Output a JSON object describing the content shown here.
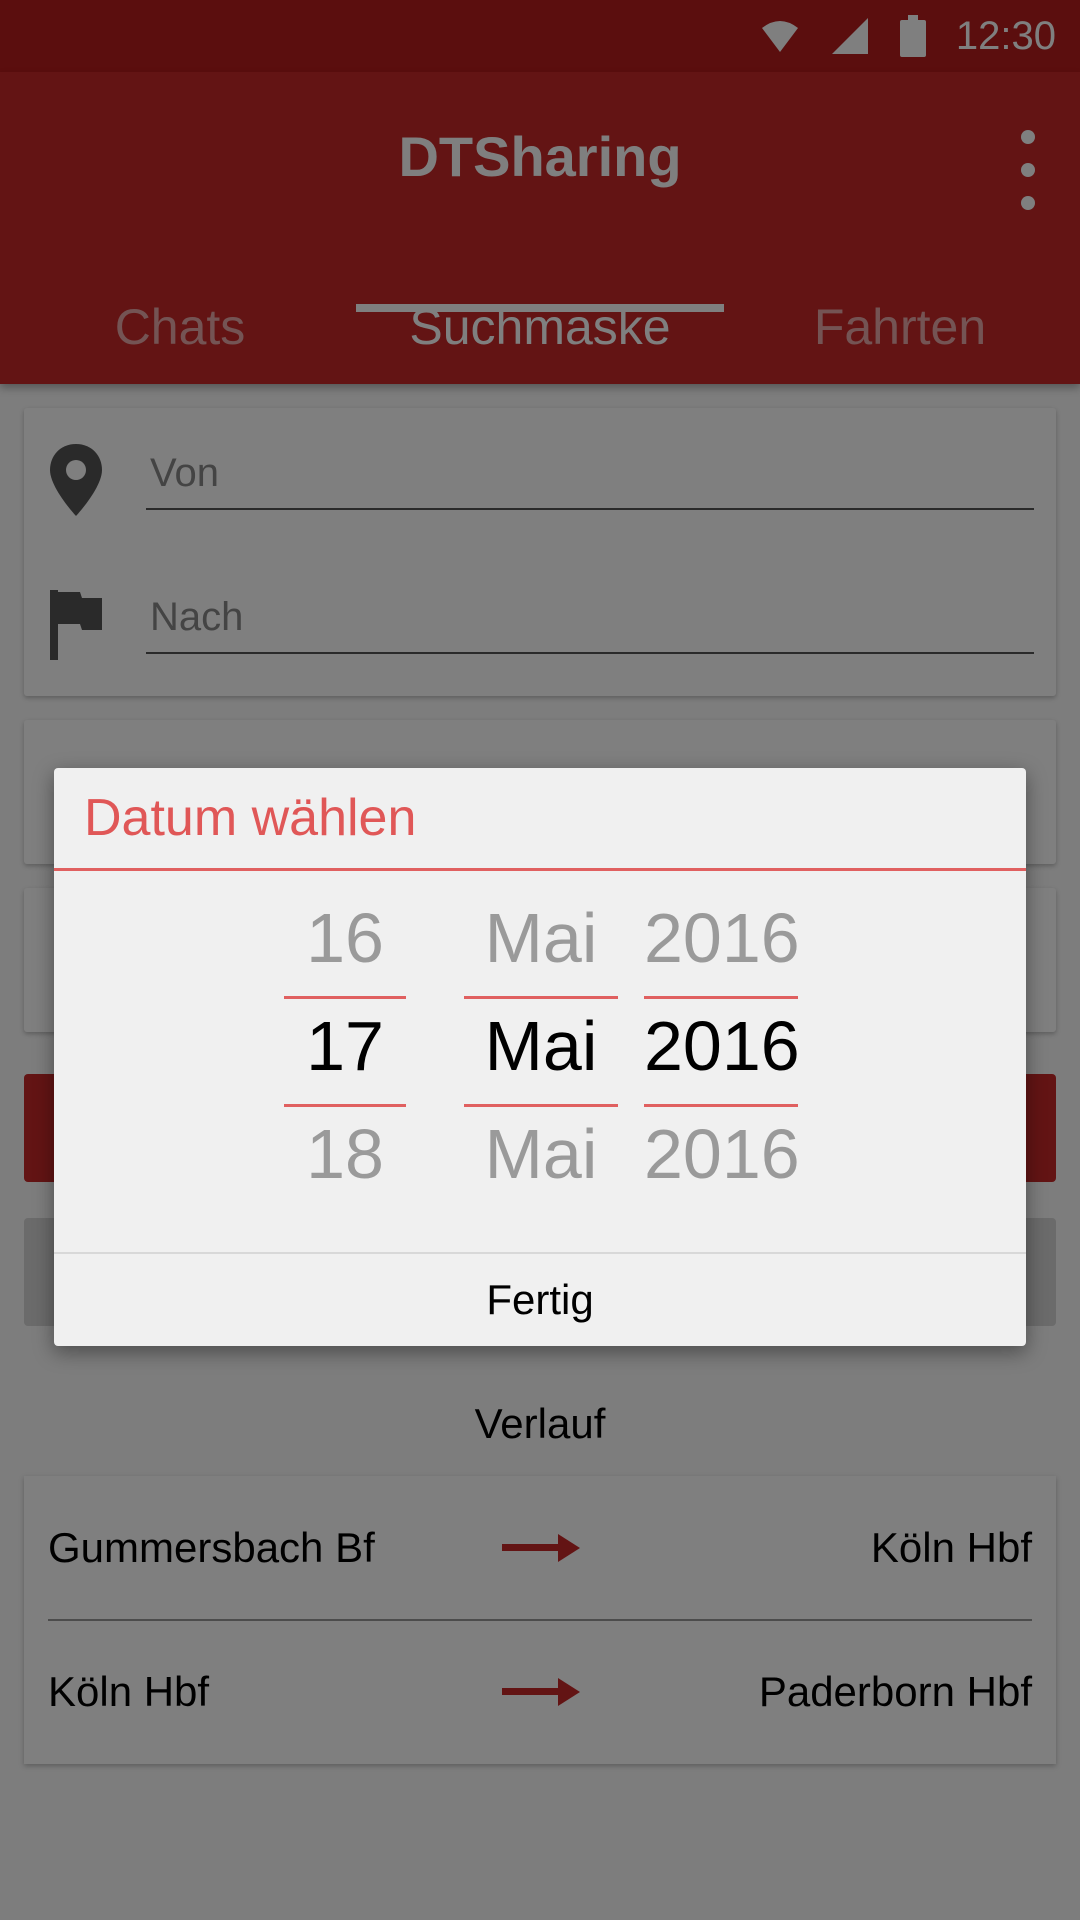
{
  "status_bar": {
    "time": "12:30"
  },
  "app_bar": {
    "title": "DTSharing",
    "tabs": [
      {
        "label": "Chats"
      },
      {
        "label": "Suchmaske"
      },
      {
        "label": "Fahrten"
      }
    ],
    "active_tab": "Suchmaske"
  },
  "search_form": {
    "from_placeholder": "Von",
    "to_placeholder": "Nach"
  },
  "history": {
    "title": "Verlauf",
    "routes": [
      {
        "from": "Gummersbach Bf",
        "to": "Köln Hbf"
      },
      {
        "from": "Köln Hbf",
        "to": "Paderborn Hbf"
      }
    ]
  },
  "date_dialog": {
    "title": "Datum wählen",
    "day": {
      "prev": "16",
      "selected": "17",
      "next": "18"
    },
    "month": {
      "prev": "Mai",
      "selected": "Mai",
      "next": "Mai"
    },
    "year": {
      "prev": "2016",
      "selected": "2016",
      "next": "2016"
    },
    "done_label": "Fertig"
  },
  "colors": {
    "primary": "#c62828",
    "primary_dark": "#b71c1c",
    "accent": "#e05757"
  },
  "icons": [
    "wifi-icon",
    "signal-icon",
    "battery-icon",
    "overflow-menu-icon",
    "location-pin-icon",
    "flag-icon",
    "arrow-right-icon"
  ]
}
